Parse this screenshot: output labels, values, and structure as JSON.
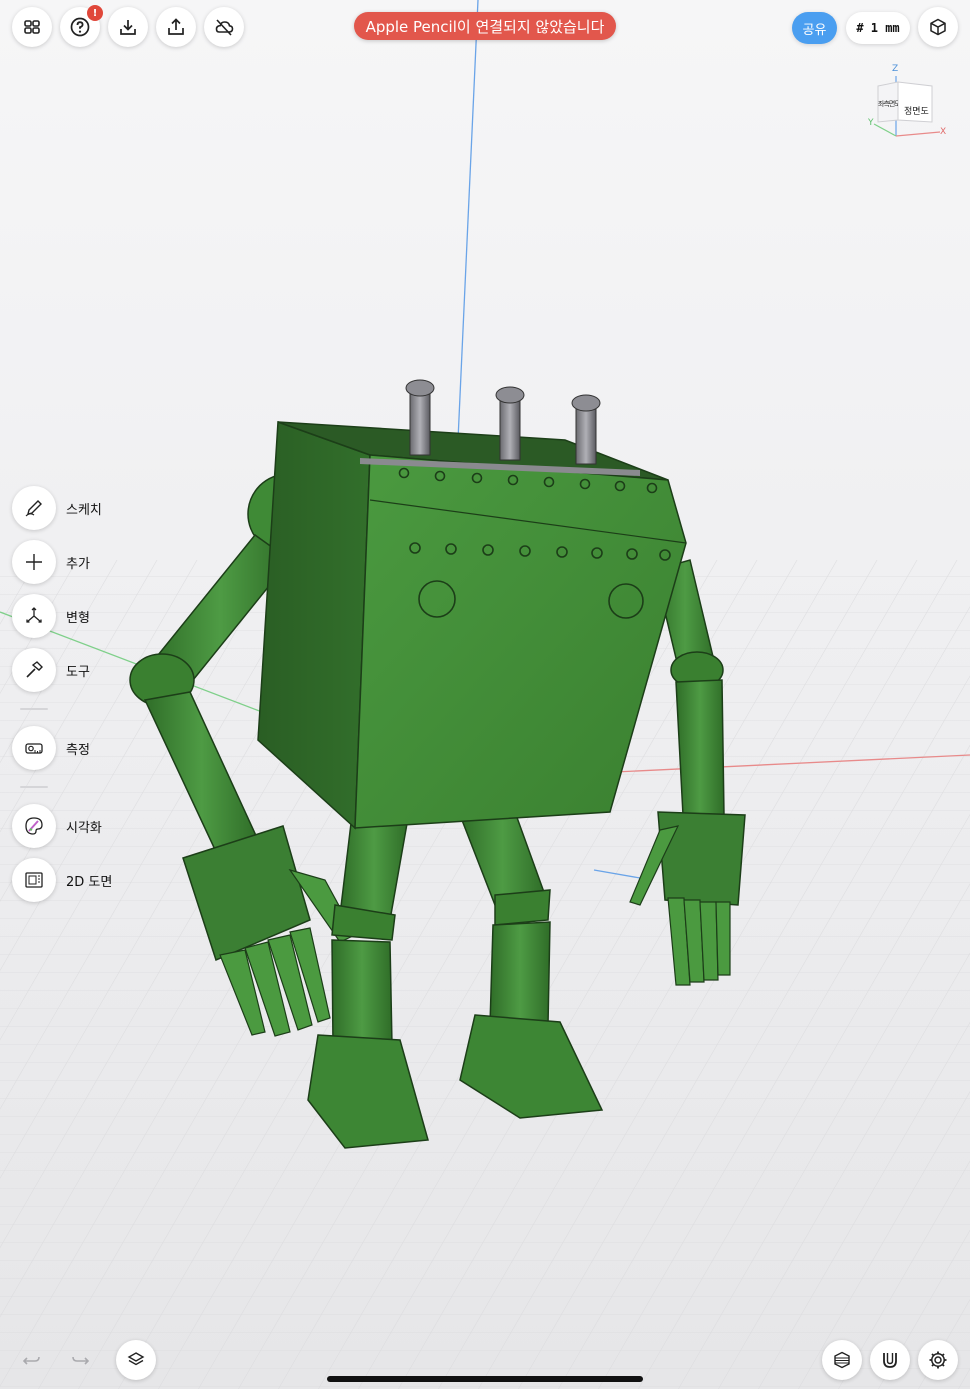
{
  "toolbar": {
    "icons": [
      "grid-icon",
      "help-icon",
      "import-icon",
      "export-icon",
      "cloud-off-icon"
    ],
    "help_badge": "!"
  },
  "toast": {
    "text": "Apple Pencil이 연결되지 않았습니다"
  },
  "top_right": {
    "share_label": "공유",
    "grid_unit": "# 1 mm"
  },
  "view_cube": {
    "front_label": "정면도",
    "side_label": "좌측면도",
    "axis_x": "X",
    "axis_y": "Y",
    "axis_z": "Z"
  },
  "tools": [
    {
      "label": "스케치",
      "icon": "sketch-pencil-icon"
    },
    {
      "label": "추가",
      "icon": "plus-icon"
    },
    {
      "label": "변형",
      "icon": "transform-icon"
    },
    {
      "label": "도구",
      "icon": "hammer-icon"
    },
    {
      "label": "측정",
      "icon": "tape-measure-icon"
    },
    {
      "label": "시각화",
      "icon": "palette-icon"
    },
    {
      "label": "2D 도면",
      "icon": "drawing-icon"
    }
  ],
  "colors": {
    "model_green": "#3f8a36",
    "share_blue": "#4a9ef0",
    "toast_red": "#e2574c"
  }
}
